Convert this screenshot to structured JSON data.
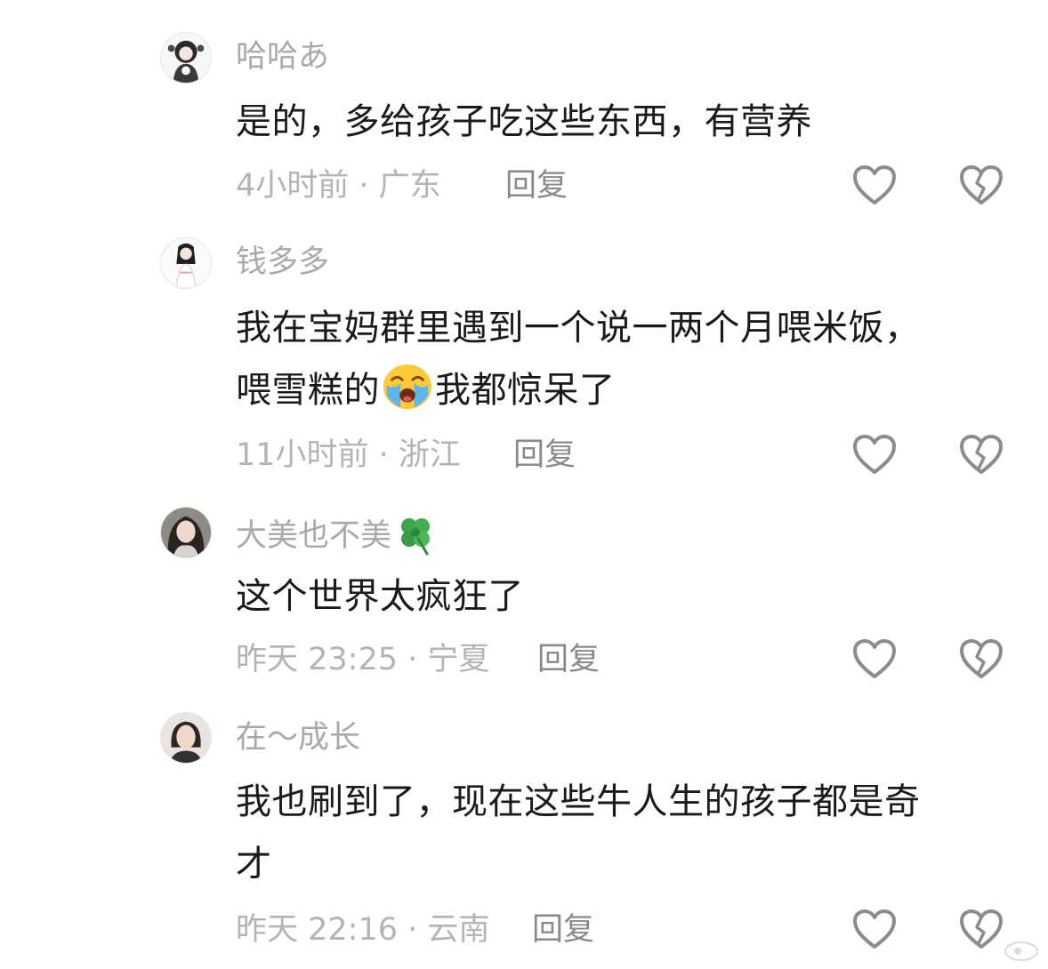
{
  "comments": [
    {
      "username": "哈哈あ",
      "text": "是的，多给孩子吃这些东西，有营养",
      "time_location": "4小时前 · 广东",
      "reply_label": "回复",
      "like_icon": "heart-outline-icon",
      "dislike_icon": "broken-heart-outline-icon"
    },
    {
      "username": "钱多多",
      "text_line1": "我在宝妈群里遇到一个说一两个月喂米饭，",
      "text_line2_before": "喂雪糕的",
      "text_line2_emoji": "loudly-crying-face-emoji",
      "text_line2_after": "我都惊呆了",
      "time_location": "11小时前 · 浙江",
      "reply_label": "回复",
      "like_icon": "heart-outline-icon",
      "dislike_icon": "broken-heart-outline-icon"
    },
    {
      "username": "大美也不美",
      "username_emoji": "four-leaf-clover-emoji",
      "text": "这个世界太疯狂了",
      "time_location": "昨天 23:25 · 宁夏",
      "reply_label": "回复",
      "like_icon": "heart-outline-icon",
      "dislike_icon": "broken-heart-outline-icon"
    },
    {
      "username": "在～成长",
      "text_line1": "我也刷到了，现在这些牛人生的孩子都是奇",
      "text_line2": "才",
      "time_location": "昨天 22:16 · 云南",
      "reply_label": "回复",
      "like_icon": "heart-outline-icon",
      "dislike_icon": "broken-heart-outline-icon"
    }
  ],
  "colors": {
    "background": "#ffffff",
    "username": "#a9a9a9",
    "text": "#1a1a1a",
    "meta": "#b4b4b4",
    "reply": "#8a8a8a",
    "icon_stroke": "#8c8c8c"
  }
}
